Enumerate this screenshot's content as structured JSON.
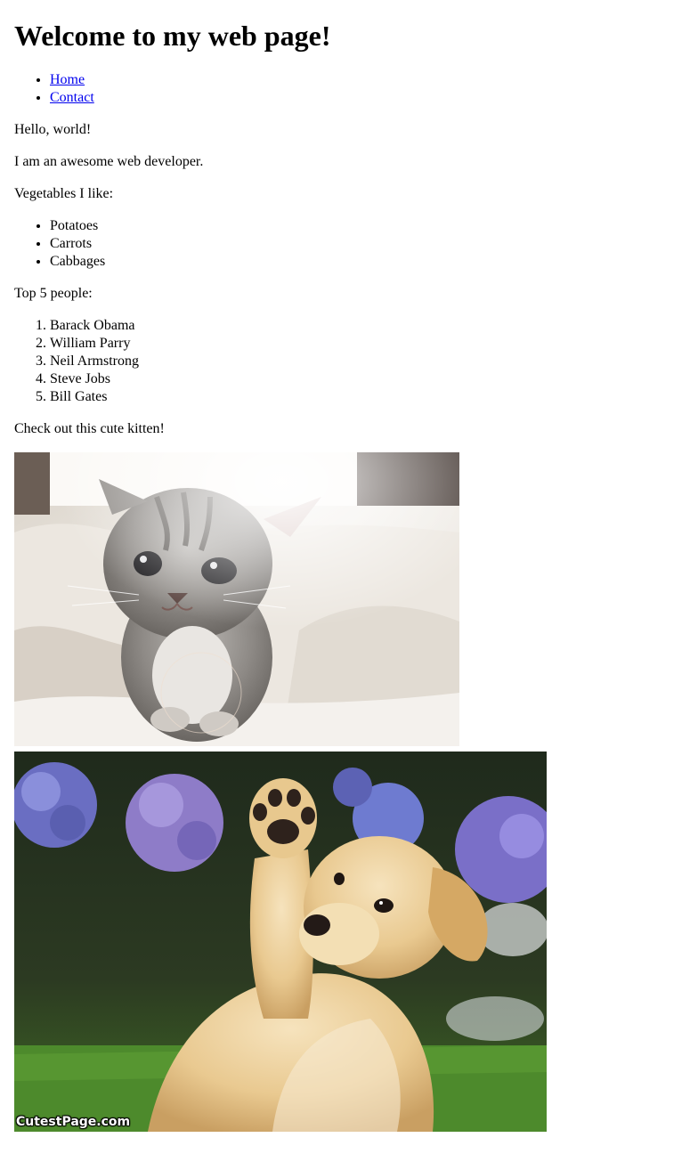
{
  "heading": "Welcome to my web page!",
  "nav": [
    {
      "label": "Home"
    },
    {
      "label": "Contact"
    }
  ],
  "greeting": "Hello, world!",
  "intro": "I am an awesome web developer.",
  "vegetables": {
    "label": "Vegetables I like:",
    "items": [
      "Potatoes",
      "Carrots",
      "Cabbages"
    ]
  },
  "people": {
    "label": "Top 5 people:",
    "items": [
      "Barack Obama",
      "William Parry",
      "Neil Armstrong",
      "Steve Jobs",
      "Bill Gates"
    ]
  },
  "kitten_caption": "Check out this cute kitten!",
  "puppy_watermark": "CutestPage.com",
  "colors": {
    "link": "#0000ee",
    "text": "#000000",
    "background": "#ffffff"
  }
}
